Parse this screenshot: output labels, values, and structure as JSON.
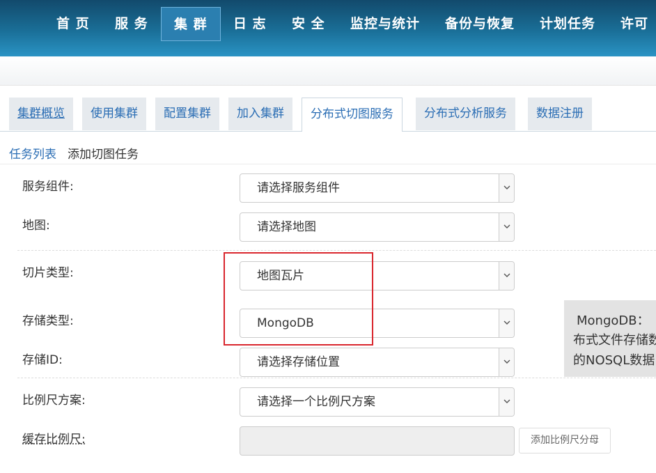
{
  "nav": {
    "items": [
      "首 页",
      "服 务",
      "集 群",
      "日 志",
      "安 全",
      "监控与统计",
      "备份与恢复",
      "计划任务",
      "许可"
    ],
    "active_index": 2
  },
  "tabs": [
    "集群概览",
    "使用集群",
    "配置集群",
    "加入集群",
    "分布式切图服务",
    "分布式分析服务",
    "数据注册"
  ],
  "active_tab_index": 4,
  "breadcrumb": {
    "link": "任务列表",
    "current": "添加切图任务"
  },
  "form": {
    "service_component": {
      "label": "服务组件:",
      "value": "请选择服务组件"
    },
    "map": {
      "label": "地图:",
      "value": "请选择地图"
    },
    "tile_type": {
      "label": "切片类型:",
      "value": "地图瓦片"
    },
    "storage_type": {
      "label": "存储类型:",
      "value": "MongoDB"
    },
    "storage_id": {
      "label": "存储ID:",
      "value": "请选择存储位置"
    },
    "scale_scheme": {
      "label": "比例尺方案:",
      "value": "请选择一个比例尺方案"
    },
    "cache_scale": {
      "label": "缓存比例尺:",
      "value": ""
    },
    "add_scale_button": "添加比例尺分母"
  },
  "tooltip": {
    "line1": "MongoDB：",
    "line2": "布式文件存储数",
    "line3": "的NOSQL数据"
  },
  "colors": {
    "nav_bg": "#1a6f98",
    "link": "#2a6db4",
    "highlight_box": "#d9262d"
  }
}
